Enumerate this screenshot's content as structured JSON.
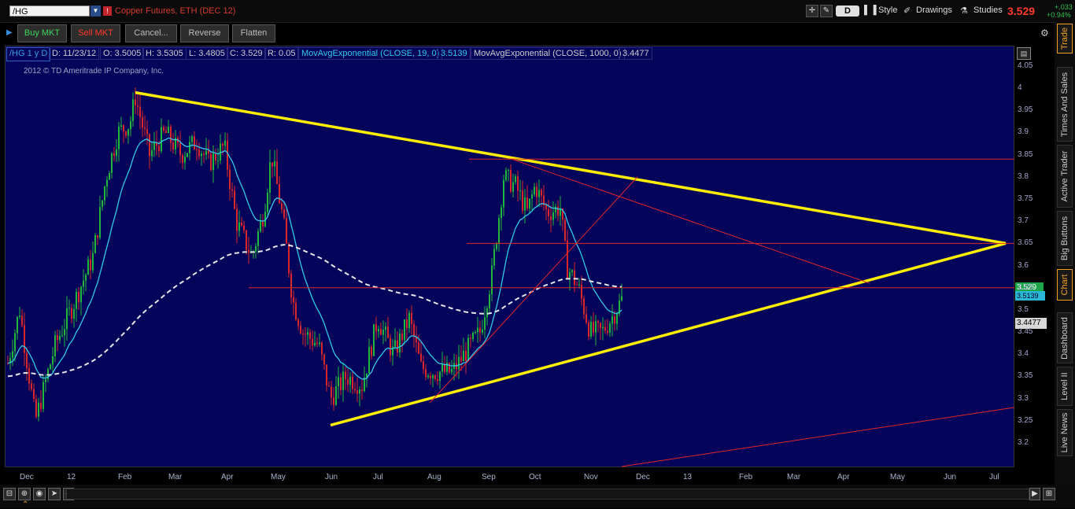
{
  "header": {
    "symbol": "/HG",
    "instrument_name": "Copper Futures, ETH (DEC 12)",
    "period": "D",
    "style_label": "Style",
    "drawings_label": "Drawings",
    "studies_label": "Studies",
    "last_price": "3.529",
    "net_change": "+.033",
    "pct_change": "+0.94%"
  },
  "orders": {
    "buy": "Buy MKT",
    "sell": "Sell MKT",
    "cancel": "Cancel...",
    "reverse": "Reverse",
    "flatten": "Flatten"
  },
  "studybar": {
    "symbol": "/HG 1 y D",
    "date": "D: 11/23/12",
    "open": "O: 3.5005",
    "high": "H: 3.5305",
    "low": "L: 3.4805",
    "close": "C: 3.529",
    "range": "R: 0.05",
    "ema19_label": "MovAvgExponential (CLOSE, 19, 0)",
    "ema19_value": "3.5139",
    "ema1000_label": "MovAvgExponential (CLOSE, 1000, 0)",
    "ema1000_value": "3.4477"
  },
  "copyright": "2012 © TD Ameritrade IP Company, Inc.",
  "price_tags": {
    "last": "3.529",
    "ema19": "3.5139",
    "ema1000": "3.4477"
  },
  "right_tabs": [
    "Trade",
    "Times And Sales",
    "Active Trader",
    "Big Buttons",
    "Chart",
    "Dashboard",
    "Level II",
    "Live News"
  ],
  "chart_data": {
    "type": "candlestick",
    "title": "",
    "xlabel": "",
    "ylabel": "",
    "ylim": [
      3.15,
      4.05
    ],
    "y_ticks": [
      "4.05",
      "4",
      "3.95",
      "3.9",
      "3.85",
      "3.8",
      "3.75",
      "3.7",
      "3.65",
      "3.6",
      "3.55",
      "3.5",
      "3.45",
      "3.4",
      "3.35",
      "3.3",
      "3.25",
      "3.2"
    ],
    "x_ticks": [
      "Dec",
      "12",
      "Feb",
      "Mar",
      "Apr",
      "May",
      "Jun",
      "Jul",
      "Aug",
      "Sep",
      "Oct",
      "Nov",
      "Dec",
      "13",
      "Feb",
      "Mar",
      "Apr",
      "May",
      "Jun",
      "Jul"
    ],
    "monthly_closes": [
      {
        "x": "Dec",
        "y": 3.4
      },
      {
        "x": "12",
        "y": 3.55
      },
      {
        "x": "Feb",
        "y": 3.87
      },
      {
        "x": "Mar",
        "y": 3.85
      },
      {
        "x": "Apr",
        "y": 3.8
      },
      {
        "x": "May",
        "y": 3.7
      },
      {
        "x": "Jun",
        "y": 3.33
      },
      {
        "x": "Jul",
        "y": 3.43
      },
      {
        "x": "Aug",
        "y": 3.37
      },
      {
        "x": "Sep",
        "y": 3.72
      },
      {
        "x": "Oct",
        "y": 3.63
      },
      {
        "x": "Nov",
        "y": 3.529
      }
    ],
    "series": [
      {
        "name": "MovAvgExponential (CLOSE, 19, 0)",
        "color": "#33c9e8"
      },
      {
        "name": "MovAvgExponential (CLOSE, 1000, 0)",
        "color": "#e0e0e0"
      }
    ],
    "drawings": {
      "yellow_triangle_upper": [
        {
          "x": "Feb",
          "y": 3.99
        },
        {
          "x": "Jul",
          "y": 3.65
        }
      ],
      "yellow_triangle_lower": [
        {
          "x": "Jun",
          "y": 3.24
        },
        {
          "x": "Jul",
          "y": 3.65
        }
      ],
      "red_horizontal": [
        3.84,
        3.65,
        3.55
      ]
    }
  }
}
